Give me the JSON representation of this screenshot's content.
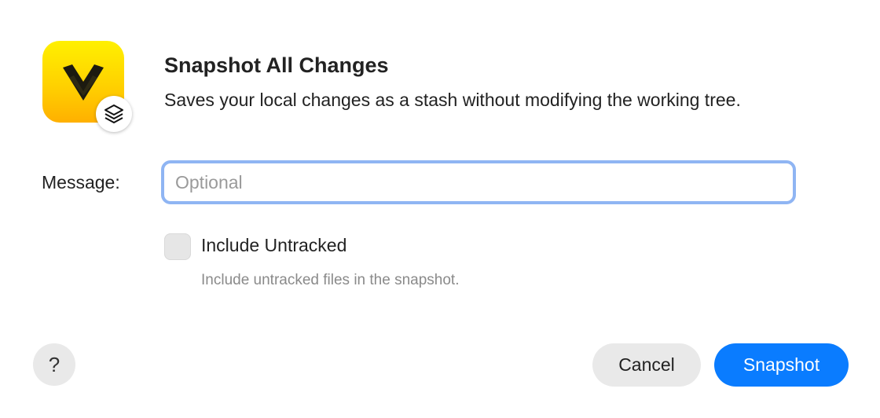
{
  "dialog": {
    "title": "Snapshot All Changes",
    "subtitle": "Saves your local changes as a stash without modifying the working tree.",
    "app_icon": "app-logo-icon",
    "badge_icon": "layers-icon"
  },
  "form": {
    "message_label": "Message:",
    "message_value": "",
    "message_placeholder": "Optional",
    "include_untracked_label": "Include Untracked",
    "include_untracked_checked": false,
    "include_untracked_help": "Include untracked files in the snapshot."
  },
  "footer": {
    "help_label": "?",
    "cancel_label": "Cancel",
    "primary_label": "Snapshot"
  },
  "colors": {
    "accent": "#0a7cff",
    "focus_ring": "#8fb5f3",
    "icon_yellow": "#ffd100"
  }
}
